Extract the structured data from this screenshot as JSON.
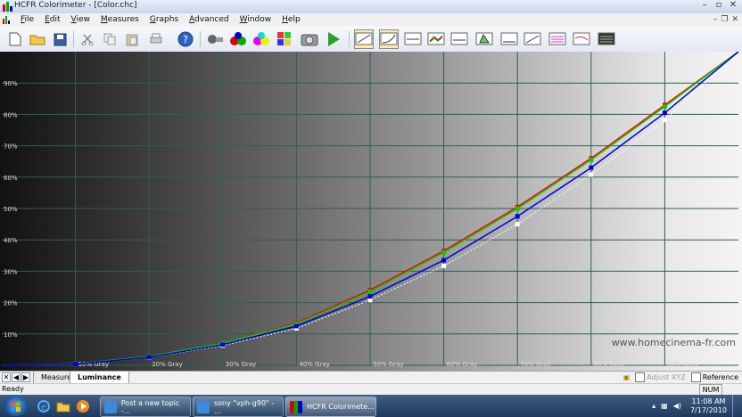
{
  "window": {
    "title": "HCFR Colorimeter - [Color.chc]"
  },
  "menu": [
    {
      "label": "File",
      "key": "F",
      "rest": "ile"
    },
    {
      "label": "Edit",
      "key": "E",
      "rest": "dit"
    },
    {
      "label": "View",
      "key": "V",
      "rest": "iew"
    },
    {
      "label": "Measures",
      "key": "M",
      "rest": "easures"
    },
    {
      "label": "Graphs",
      "key": "G",
      "rest": "raphs"
    },
    {
      "label": "Advanced",
      "key": "A",
      "rest": "dvanced"
    },
    {
      "label": "Window",
      "key": "W",
      "rest": "indow"
    },
    {
      "label": "Help",
      "key": "H",
      "rest": "elp"
    }
  ],
  "chart_data": {
    "type": "line",
    "y_tick_labels": [
      "10%",
      "20%",
      "30%",
      "40%",
      "50%",
      "60%",
      "70%",
      "80%",
      "90%"
    ],
    "x_tick_labels": [
      "10% Gray",
      "20% Gray",
      "30% Gray",
      "40% Gray",
      "50% Gray",
      "60% Gray",
      "70% Gray",
      "80% Gray",
      "90% Gray"
    ],
    "x": [
      0,
      10,
      20,
      30,
      40,
      50,
      60,
      70,
      80,
      90,
      100
    ],
    "ylim": [
      0,
      100
    ],
    "watermark": "www.homecinema-fr.com",
    "series": [
      {
        "color": "#ff0000",
        "values": [
          0,
          0.5,
          2.8,
          7.0,
          13.5,
          24.0,
          36.5,
          50.5,
          66.0,
          83.0,
          100
        ]
      },
      {
        "color": "#00d000",
        "values": [
          0,
          0.5,
          2.8,
          7.0,
          13.2,
          23.5,
          36.0,
          50.0,
          65.5,
          82.5,
          100
        ]
      },
      {
        "color": "#0000e0",
        "values": [
          0,
          0.4,
          2.6,
          6.6,
          12.5,
          22.0,
          33.5,
          47.5,
          63.0,
          80.5,
          100
        ]
      },
      {
        "color": "#ffffff",
        "values": [
          0,
          0.4,
          2.5,
          6.3,
          11.8,
          20.8,
          31.7,
          45.0,
          60.8,
          78.2,
          100
        ]
      }
    ]
  },
  "tabs": [
    "Measures",
    "Luminance"
  ],
  "checkboxes": {
    "adjust": "Adjust XYZ",
    "reference": "Reference"
  },
  "status": {
    "text": "Ready",
    "num": "NUM"
  },
  "taskbar": {
    "tasks": [
      "Post a new topic -...",
      "sony \"vph-g90\" - ...",
      "HCFR Colorimete..."
    ],
    "time": "11:08 AM",
    "date": "7/17/2010"
  }
}
